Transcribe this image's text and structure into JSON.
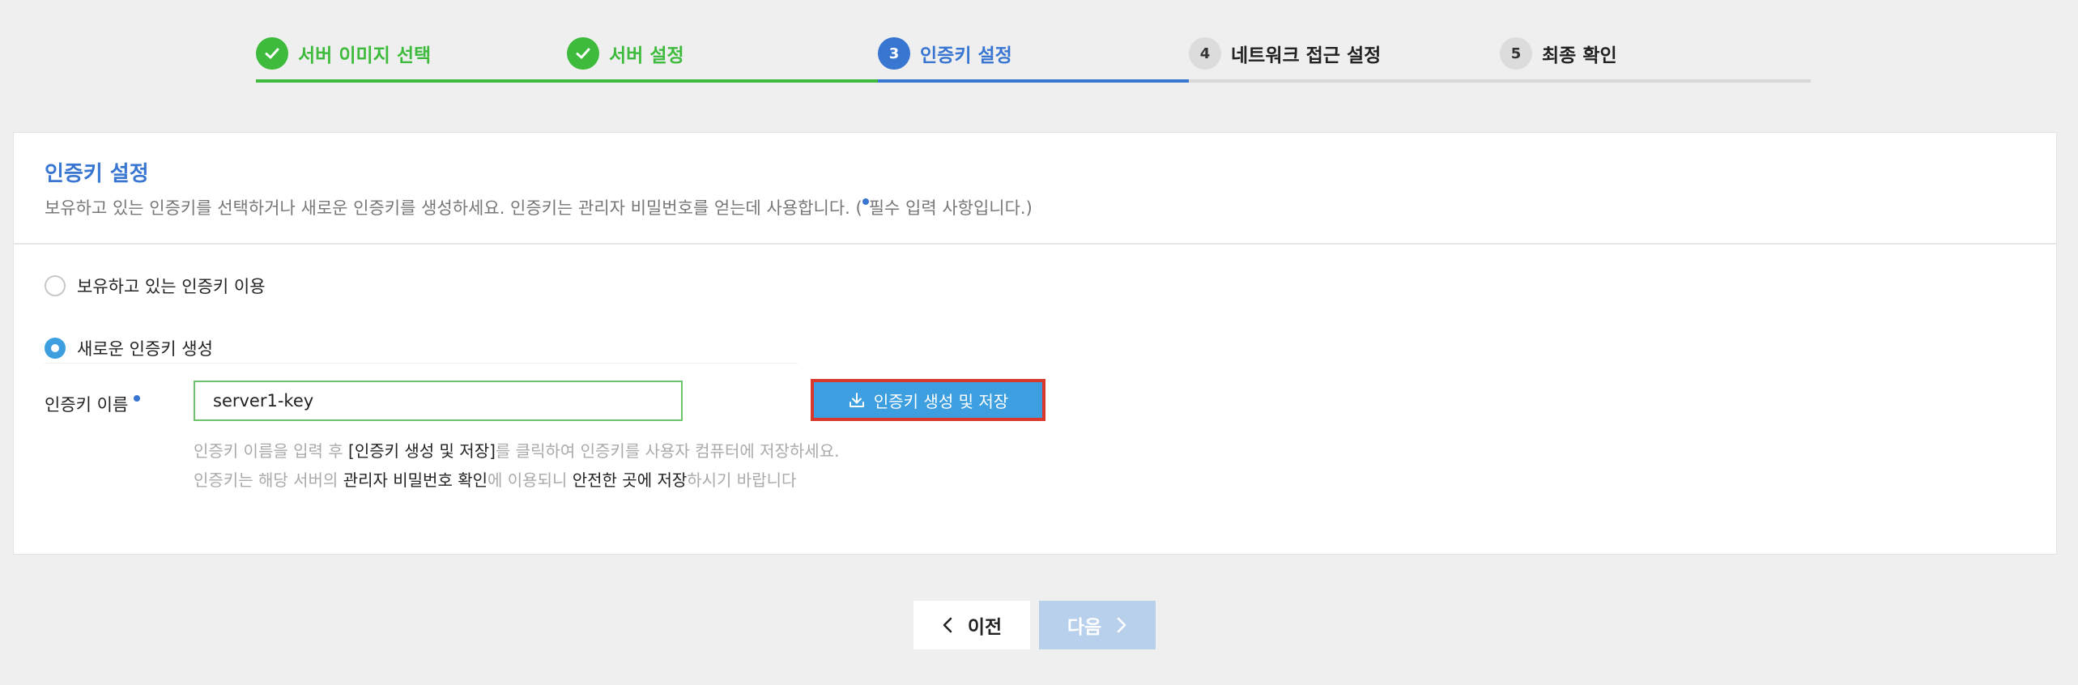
{
  "steps": [
    {
      "number": "",
      "label": "서버 이미지 선택",
      "state": "done"
    },
    {
      "number": "",
      "label": "서버 설정",
      "state": "done"
    },
    {
      "number": "3",
      "label": "인증키 설정",
      "state": "active"
    },
    {
      "number": "4",
      "label": "네트워크 접근 설정",
      "state": "todo"
    },
    {
      "number": "5",
      "label": "최종 확인",
      "state": "todo"
    }
  ],
  "panel": {
    "title": "인증키 설정",
    "description_before": "보유하고 있는 인증키를 선택하거나 새로운 인증키를 생성하세요. 인증키는 관리자 비밀번호를 얻는데 사용합니다. (",
    "description_after": "필수 입력 사항입니다.)"
  },
  "options": {
    "existing_label": "보유하고 있는 인증키 이용",
    "new_label": "새로운 인증키 생성",
    "selected": "new"
  },
  "key_form": {
    "label": "인증키 이름",
    "value": "server1-key",
    "button_label": "인증키 생성 및 저장"
  },
  "hints": {
    "line1": {
      "a": "인증키 이름을 입력 후 ",
      "b": "[인증키 생성 및 저장]",
      "c": "를 클릭하여 인증키를 사용자 컴퓨터에 저장하세요."
    },
    "line2": {
      "a": "인증키는 해당 서버의 ",
      "b": "관리자 비밀번호 확인",
      "c": "에 이용되니 ",
      "d": "안전한 곳에 저장",
      "e": "하시기 바랍니다"
    }
  },
  "nav": {
    "prev_label": "이전",
    "next_label": "다음"
  },
  "colors": {
    "done": "#3eba3c",
    "active": "#3876d2",
    "button": "#3d9fe0",
    "highlight_border": "#d9392d",
    "next_disabled": "#b8d0ec"
  },
  "icons": {
    "done_step": "check-icon",
    "generate": "download-icon",
    "prev": "chevron-left-icon",
    "next": "chevron-right-icon"
  }
}
